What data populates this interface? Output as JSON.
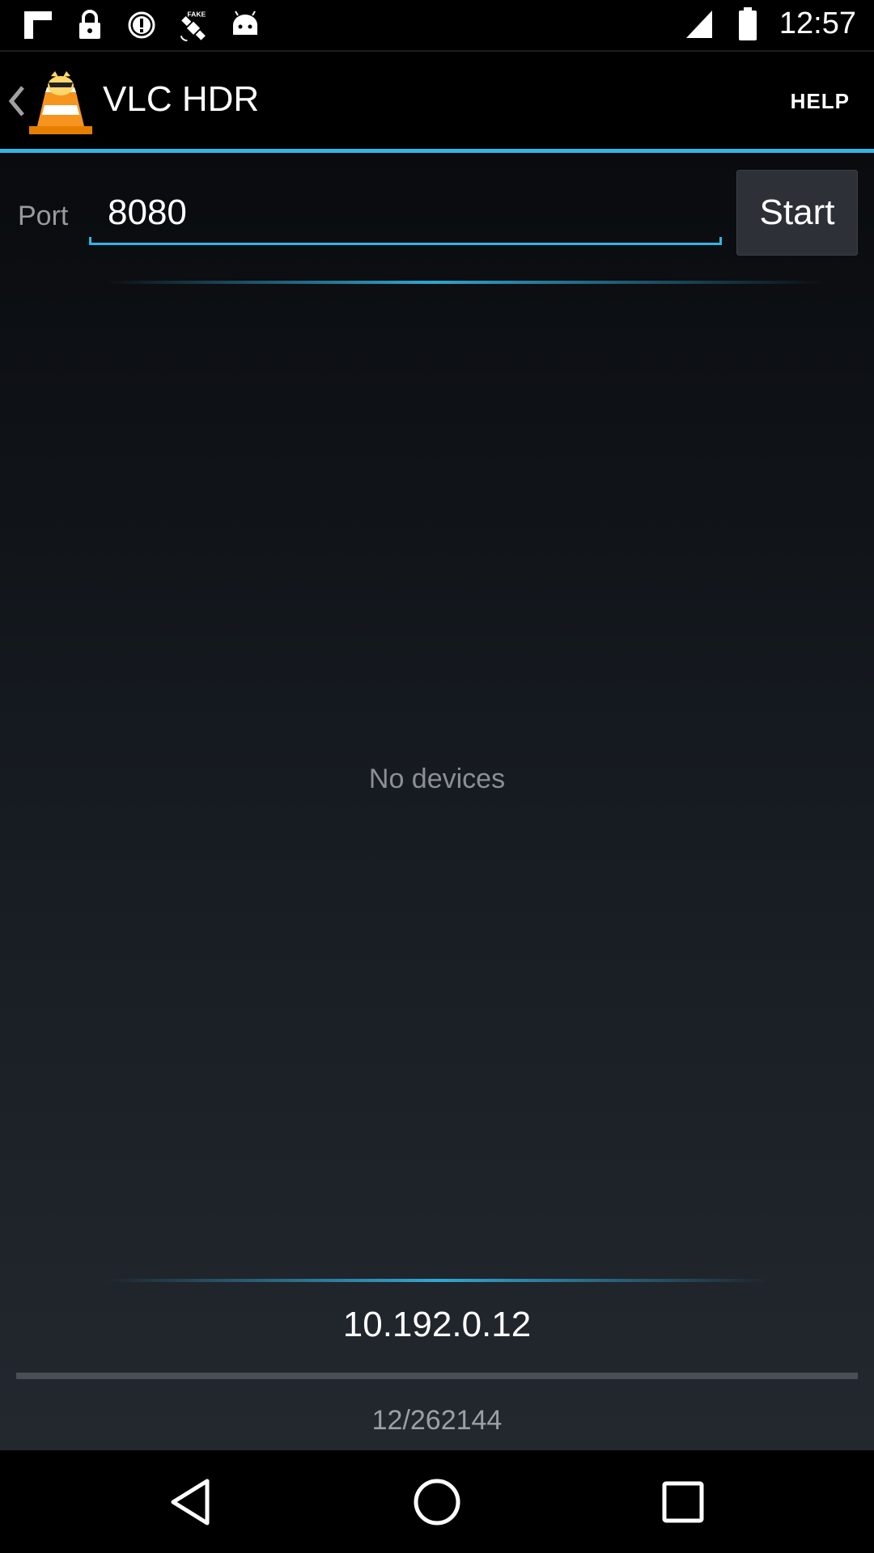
{
  "status_bar": {
    "time": "12:57",
    "left_icons": [
      "flipboard-icon",
      "lock-icon",
      "alert-circle-icon",
      "fake-gps-satellite-icon",
      "android-icon"
    ],
    "right_icons": [
      "signal-icon",
      "battery-icon"
    ]
  },
  "action_bar": {
    "title": "VLC HDR",
    "help_label": "HELP",
    "accent_color": "#33b5e5"
  },
  "port_section": {
    "label": "Port",
    "value": "8080",
    "start_label": "Start"
  },
  "devices": {
    "empty_text": "No devices"
  },
  "footer": {
    "ip": "10.192.0.12",
    "progress_text": "12/262144",
    "progress_fraction": 4.58e-05
  },
  "nav_bar": {
    "buttons": [
      "back-icon",
      "home-icon",
      "recents-icon"
    ]
  }
}
